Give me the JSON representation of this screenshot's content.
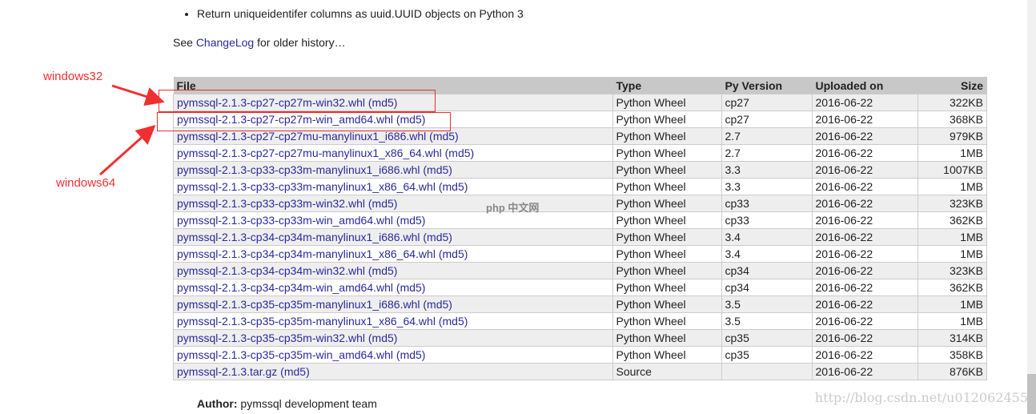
{
  "notes": [
    "Return uniqueidentifer columns as uuid.UUID objects on Python 3"
  ],
  "see": {
    "prefix": "See ",
    "link": "ChangeLog",
    "suffix": " for older history…"
  },
  "annotations": {
    "win32": "windows32",
    "win64": "windows64",
    "color": "#f03030"
  },
  "table": {
    "headers": [
      "File",
      "Type",
      "Py Version",
      "Uploaded on",
      "Size"
    ],
    "rows": [
      [
        "pymssql-2.1.3-cp27-cp27m-win32.whl",
        "Python Wheel",
        "cp27",
        "2016-06-22",
        "322KB"
      ],
      [
        "pymssql-2.1.3-cp27-cp27m-win_amd64.whl",
        "Python Wheel",
        "cp27",
        "2016-06-22",
        "368KB"
      ],
      [
        "pymssql-2.1.3-cp27-cp27mu-manylinux1_i686.whl",
        "Python Wheel",
        "2.7",
        "2016-06-22",
        "979KB"
      ],
      [
        "pymssql-2.1.3-cp27-cp27mu-manylinux1_x86_64.whl",
        "Python Wheel",
        "2.7",
        "2016-06-22",
        "1MB"
      ],
      [
        "pymssql-2.1.3-cp33-cp33m-manylinux1_i686.whl",
        "Python Wheel",
        "3.3",
        "2016-06-22",
        "1007KB"
      ],
      [
        "pymssql-2.1.3-cp33-cp33m-manylinux1_x86_64.whl",
        "Python Wheel",
        "3.3",
        "2016-06-22",
        "1MB"
      ],
      [
        "pymssql-2.1.3-cp33-cp33m-win32.whl",
        "Python Wheel",
        "cp33",
        "2016-06-22",
        "323KB"
      ],
      [
        "pymssql-2.1.3-cp33-cp33m-win_amd64.whl",
        "Python Wheel",
        "cp33",
        "2016-06-22",
        "362KB"
      ],
      [
        "pymssql-2.1.3-cp34-cp34m-manylinux1_i686.whl",
        "Python Wheel",
        "3.4",
        "2016-06-22",
        "1MB"
      ],
      [
        "pymssql-2.1.3-cp34-cp34m-manylinux1_x86_64.whl",
        "Python Wheel",
        "3.4",
        "2016-06-22",
        "1MB"
      ],
      [
        "pymssql-2.1.3-cp34-cp34m-win32.whl",
        "Python Wheel",
        "cp34",
        "2016-06-22",
        "323KB"
      ],
      [
        "pymssql-2.1.3-cp34-cp34m-win_amd64.whl",
        "Python Wheel",
        "cp34",
        "2016-06-22",
        "362KB"
      ],
      [
        "pymssql-2.1.3-cp35-cp35m-manylinux1_i686.whl",
        "Python Wheel",
        "3.5",
        "2016-06-22",
        "1MB"
      ],
      [
        "pymssql-2.1.3-cp35-cp35m-manylinux1_x86_64.whl",
        "Python Wheel",
        "3.5",
        "2016-06-22",
        "1MB"
      ],
      [
        "pymssql-2.1.3-cp35-cp35m-win32.whl",
        "Python Wheel",
        "cp35",
        "2016-06-22",
        "314KB"
      ],
      [
        "pymssql-2.1.3-cp35-cp35m-win_amd64.whl",
        "Python Wheel",
        "cp35",
        "2016-06-22",
        "358KB"
      ],
      [
        "pymssql-2.1.3.tar.gz",
        "Source",
        "",
        "2016-06-22",
        "876KB"
      ]
    ],
    "md5_label": "(md5)"
  },
  "author": {
    "label": "Author:",
    "value": " pymssql development team"
  },
  "logo": "php 中文网",
  "watermark": "http://blog.csdn.net/u012062455"
}
